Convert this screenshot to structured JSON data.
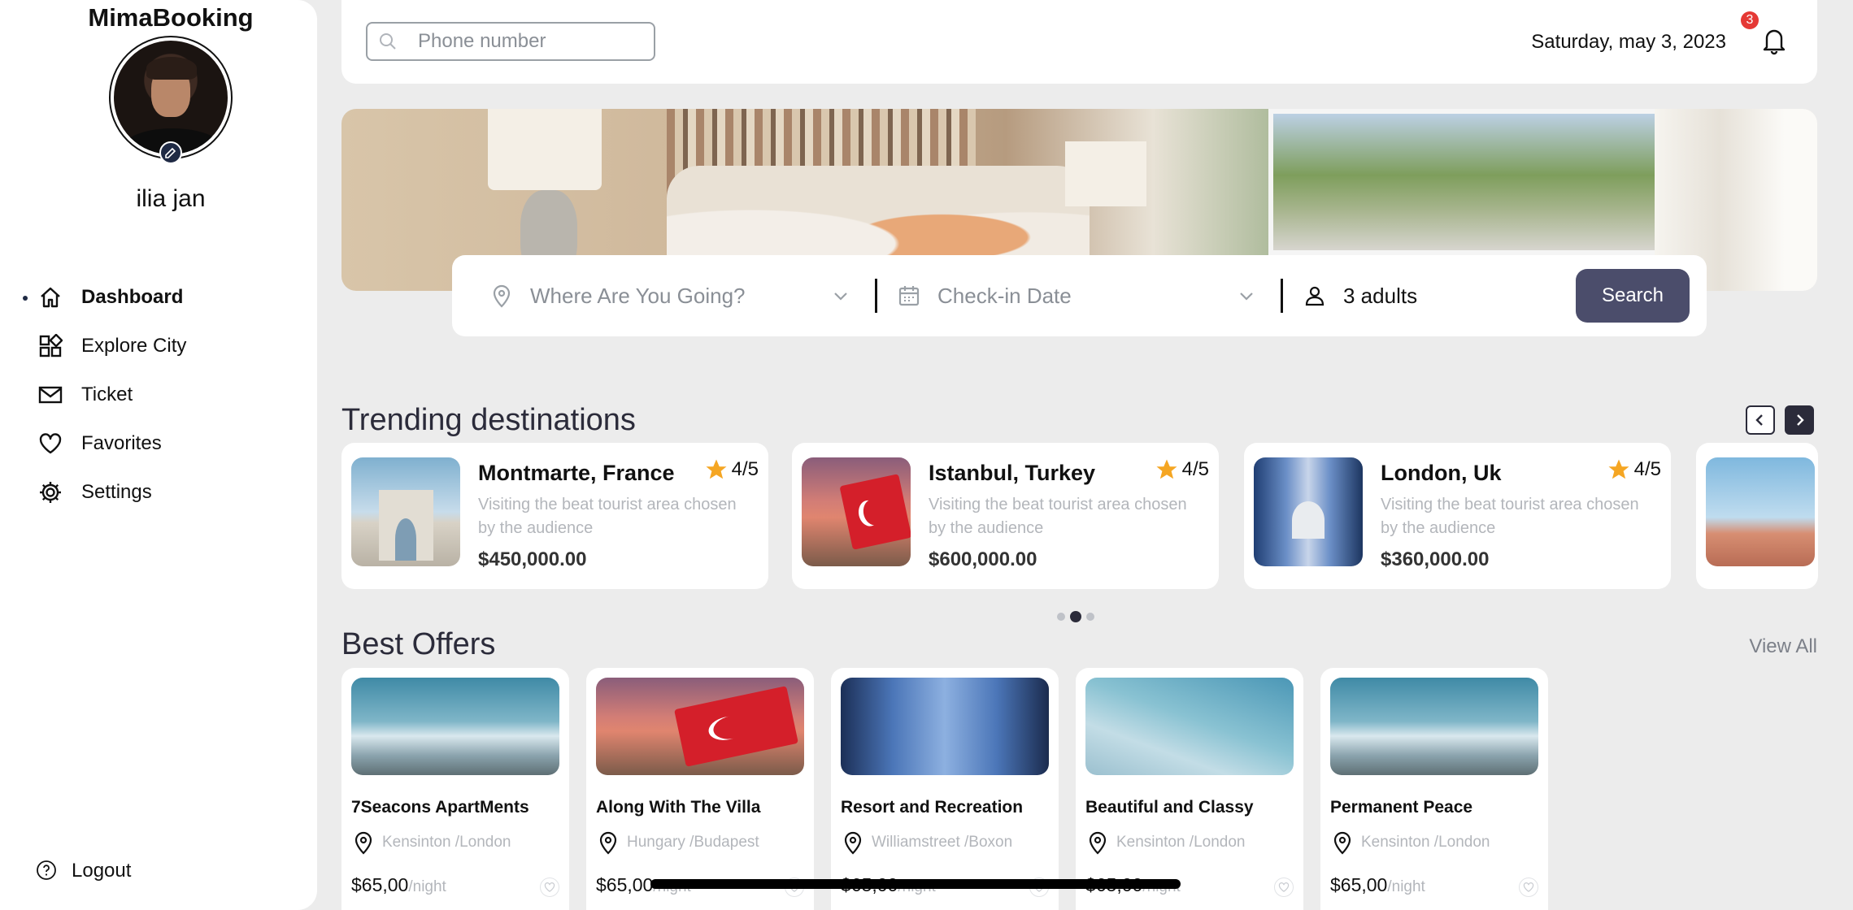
{
  "sidebar": {
    "brand": "MimaBooking",
    "username": "ilia jan",
    "items": [
      {
        "label": "Dashboard",
        "icon": "home-icon",
        "active": true
      },
      {
        "label": "Explore City",
        "icon": "grid-icon",
        "active": false
      },
      {
        "label": "Ticket",
        "icon": "mail-icon",
        "active": false
      },
      {
        "label": "Favorites",
        "icon": "heart-icon",
        "active": false
      },
      {
        "label": "Settings",
        "icon": "gear-icon",
        "active": false
      }
    ],
    "logout": "Logout"
  },
  "topbar": {
    "search_placeholder": "Phone number",
    "date": "Saturday, may 3, 2023",
    "notification_count": "3"
  },
  "booking": {
    "where_placeholder": "Where Are You Going?",
    "date_placeholder": "Check-in Date",
    "guests": "3 adults",
    "search_label": "Search"
  },
  "trending": {
    "title": "Trending destinations",
    "cards": [
      {
        "name": "Montmarte, France",
        "rating": "4/5",
        "desc": "Visiting the beat tourist area chosen by the audience",
        "price": "$450,000.00"
      },
      {
        "name": "Istanbul, Turkey",
        "rating": "4/5",
        "desc": "Visiting the beat tourist area chosen by the audience",
        "price": "$600,000.00"
      },
      {
        "name": "London, Uk",
        "rating": "4/5",
        "desc": "Visiting the beat tourist area chosen by the audience",
        "price": "$360,000.00"
      }
    ],
    "page_dots": 3,
    "active_dot": 2
  },
  "offers": {
    "title": "Best Offers",
    "view_all": "View All",
    "cards": [
      {
        "title": "7Seacons ApartMents",
        "location": "Kensinton /London",
        "price": "$65,00",
        "unit": "/night"
      },
      {
        "title": "Along With The Villa",
        "location": "Hungary /Budapest",
        "price": "$65,00",
        "unit": "/night"
      },
      {
        "title": "Resort and Recreation",
        "location": "Williamstreet /Boxon",
        "price": "$65,00",
        "unit": "/night"
      },
      {
        "title": "Beautiful and Classy",
        "location": "Kensinton /London",
        "price": "$65,00",
        "unit": "/night"
      },
      {
        "title": "Permanent Peace",
        "location": "Kensinton /London",
        "price": "$65,00",
        "unit": "/night"
      }
    ]
  },
  "colors": {
    "accent": "#4b4d6b",
    "star": "#f5a623",
    "badge": "#e53935",
    "background": "#ececec"
  }
}
